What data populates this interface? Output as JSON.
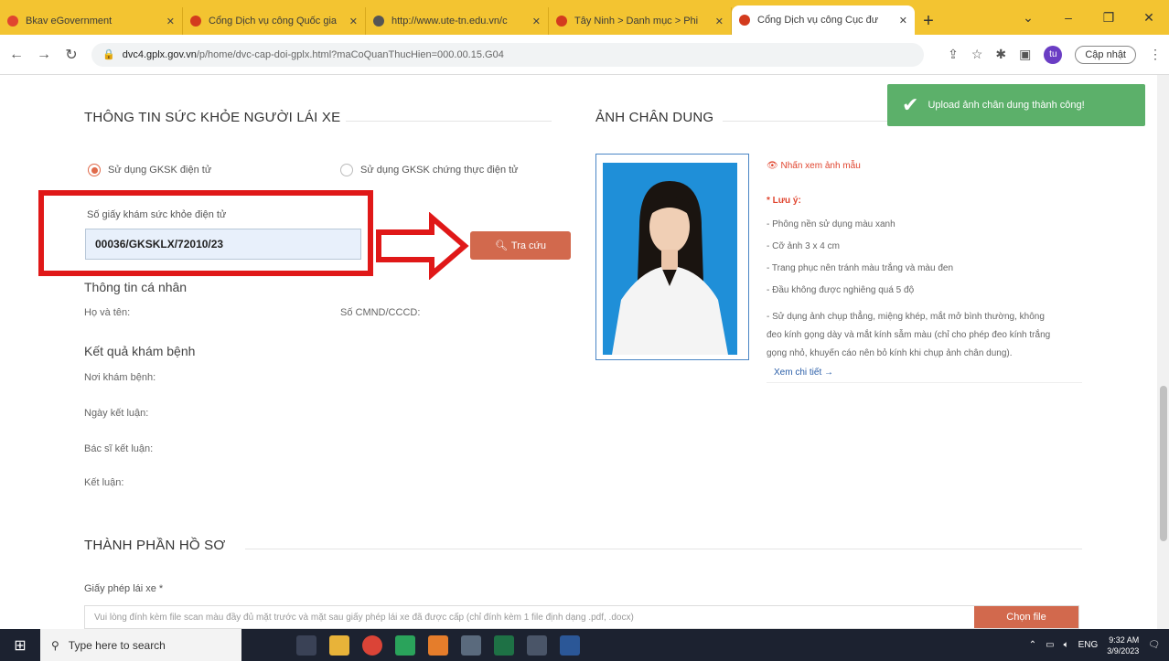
{
  "browser": {
    "tabs": [
      {
        "label": "Bkav eGovernment",
        "fav_color": "#e0452f"
      },
      {
        "label": "Cổng Dịch vụ công Quốc gia",
        "fav_color": "#d33b1e"
      },
      {
        "label": "http://www.ute-tn.edu.vn/c",
        "fav_color": "#555555"
      },
      {
        "label": "Tây Ninh > Danh mục > Phi",
        "fav_color": "#d33b1e"
      },
      {
        "label": "Cổng Dịch vụ công Cục đư",
        "fav_color": "#d33b1e"
      }
    ],
    "url_host": "dvc4.gplx.gov.vn",
    "url_rest": "/p/home/dvc-cap-doi-gplx.html?maCoQuanThucHien=000.00.15.G04",
    "profile_initial": "tu",
    "update_label": "Cập nhật"
  },
  "toast": {
    "message": "Upload ảnh chân dung thành công!"
  },
  "health": {
    "title": "THÔNG TIN SỨC KHỎE NGƯỜI LÁI XE",
    "radio1": "Sử dụng GKSK điện tử",
    "radio2": "Sử dụng GKSK chứng thực điện tử",
    "cert_label": "Số giấy khám sức khỏe điện tử",
    "cert_value": "00036/GKSKLX/72010/23",
    "search_label": "Tra cứu",
    "personal_title": "Thông tin cá nhân",
    "name_label": "Họ và tên:",
    "id_label": "Số CMND/CCCD:",
    "result_title": "Kết quả khám bệnh",
    "place_label": "Nơi khám bệnh:",
    "date_label": "Ngày kết luận:",
    "doctor_label": "Bác sĩ kết luận:",
    "conclusion_label": "Kết luận:"
  },
  "portrait": {
    "title": "ẢNH CHÂN DUNG",
    "sample_link": "Nhấn xem ảnh mẫu",
    "note_title": "* Lưu ý:",
    "notes": [
      "- Phông nền sử dụng màu xanh",
      "- Cỡ ảnh 3 x 4 cm",
      "- Trang phục nên tránh màu trắng và màu đen",
      "- Đầu không được nghiêng quá 5 độ",
      "- Sử dụng ảnh chụp thẳng, miệng khép, mắt mở bình thường, không",
      "đeo kính gọng dày và mắt kính sẫm màu (chỉ cho phép đeo kính trắng",
      "gọng nhỏ, khuyến cáo nên bỏ kính khi chụp ảnh chân dung)."
    ],
    "detail_link": "Xem chi tiết →"
  },
  "docs": {
    "title": "THÀNH PHẦN HỒ SƠ",
    "license_label": "Giấy phép lái xe *",
    "upload_hint": "Vui lòng đính kèm file scan màu đầy đủ mặt trước và mặt sau giấy phép lái xe đã được cấp (chỉ đính kèm 1 file định dạng .pdf, .docx)",
    "choose_label": "Chọn file"
  },
  "taskbar": {
    "search_placeholder": "Type here to search",
    "lang": "ENG",
    "time": "9:32 AM",
    "date": "3/9/2023"
  }
}
